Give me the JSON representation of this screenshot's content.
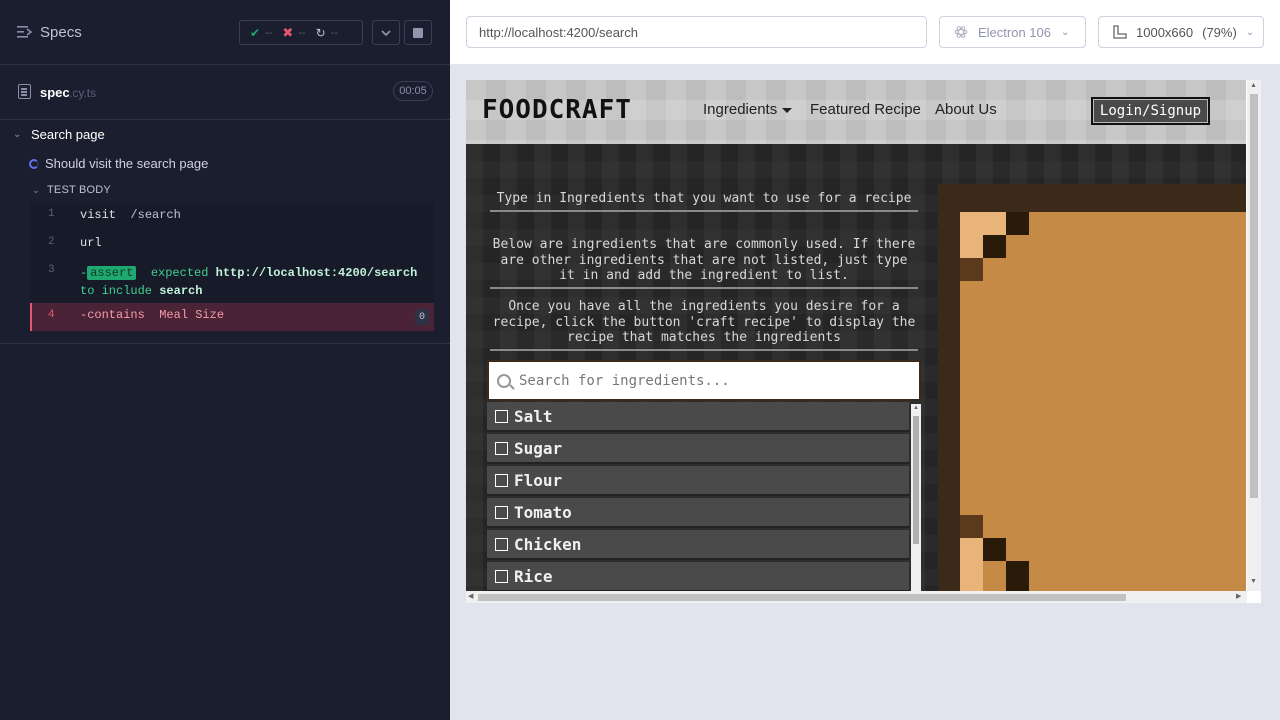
{
  "reporter": {
    "specs_title": "Specs",
    "stats": {
      "passed": "--",
      "failed": "--",
      "pending": "--"
    },
    "spec": {
      "name": "spec",
      "ext": ".cy.ts",
      "duration": "00:05"
    },
    "suite_title": "Search page",
    "test_title": "Should visit the search page",
    "test_body_label": "TEST BODY",
    "commands": [
      {
        "num": "1",
        "name": "visit",
        "arg": "/search"
      },
      {
        "num": "2",
        "name": "url",
        "arg": ""
      },
      {
        "num": "3",
        "prefix": "-",
        "name": "assert",
        "text1": "expected",
        "url": "http://localhost:4200/search",
        "text2": "to include",
        "arg": "search"
      },
      {
        "num": "4",
        "prefix": "-",
        "name": "contains",
        "arg": "Meal Size",
        "count": "0"
      }
    ]
  },
  "browser": {
    "url": "http://localhost:4200/search",
    "browser_name": "Electron 106",
    "viewport": "1000x660",
    "zoom": "(79%)"
  },
  "app": {
    "logo": "FOODCRAFT",
    "nav": {
      "ingredients": "Ingredients",
      "featured": "Featured Recipe",
      "about": "About Us",
      "login": "Login/Signup"
    },
    "instructions": [
      "Type in Ingredients that you want to use for a recipe",
      "Below are ingredients that are commonly used. If there are other ingredients that are not listed, just type it in and add the ingredient to list.",
      "Once you have all the ingredients you desire for a recipe, click the button 'craft recipe' to display the recipe that matches the ingredients"
    ],
    "search_placeholder": "Search for ingredients...",
    "ingredients": [
      "Salt",
      "Sugar",
      "Flour",
      "Tomato",
      "Chicken",
      "Rice"
    ]
  },
  "colors": {
    "accent_pass": "#1fa971",
    "accent_fail": "#e45770",
    "accent_running": "#6470f3",
    "recipe_paper": "#c58a45"
  }
}
